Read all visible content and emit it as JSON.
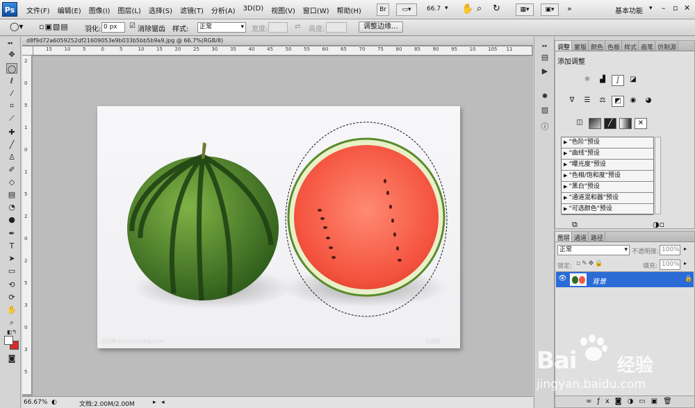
{
  "app": {
    "logo": "Ps"
  },
  "menubar": {
    "items": [
      "文件(F)",
      "编辑(E)",
      "图像(I)",
      "图层(L)",
      "选择(S)",
      "滤镜(T)",
      "分析(A)",
      "3D(D)",
      "视图(V)",
      "窗口(W)",
      "帮助(H)"
    ],
    "br": "Br",
    "zoom": "66.7",
    "workspace": "基本功能"
  },
  "options": {
    "feather_label": "羽化:",
    "feather_value": "0 px",
    "antialias_label": "消除锯齿",
    "style_label": "样式:",
    "style_value": "正常",
    "width_label": "宽度:",
    "height_label": "高度:",
    "refine_edge": "调整边缘..."
  },
  "document": {
    "tab_title": "d8f9d72a6059252df21609053e9b033b5bb5b9a9.jpg @ 66.7%(RGB/8)",
    "ruler_top": [
      "15",
      "10",
      "5",
      "0",
      "5",
      "10",
      "15",
      "20",
      "25",
      "30",
      "35",
      "40",
      "45",
      "50",
      "55",
      "60",
      "65",
      "70",
      "75",
      "80",
      "85",
      "90",
      "95",
      "10",
      "105",
      "11"
    ],
    "ruler_left": [
      "2",
      "0",
      "5",
      "1",
      "0",
      "1",
      "5",
      "2",
      "0",
      "2",
      "5",
      "3",
      "0",
      "3",
      "5"
    ],
    "watermark_left": "全景网 www.quanjing.com",
    "watermark_right": "全景网"
  },
  "status": {
    "zoom": "66.67%",
    "doc": "文档:2.00M/2.00M"
  },
  "adjust_panel": {
    "tabs": [
      "调整",
      "蒙版",
      "颜色",
      "色板",
      "样式",
      "画笔",
      "仿制源"
    ],
    "title": "添加调整",
    "presets": [
      "\"色阶\"预设",
      "\"曲线\"预设",
      "\"曝光度\"预设",
      "\"色相/饱和度\"预设",
      "\"黑白\"预设",
      "\"通道混和器\"预设",
      "\"可选颜色\"预设"
    ]
  },
  "layers_panel": {
    "tabs": [
      "图层",
      "通道",
      "路径"
    ],
    "blend_mode": "正常",
    "opacity_label": "不透明度:",
    "opacity_value": "100%",
    "lock_label": "锁定:",
    "fill_label": "填充:",
    "fill_value": "100%",
    "layer_name": "背景"
  },
  "watermark": {
    "brand": "Bai",
    "brand2": "经验",
    "url": "jingyan.baidu.com"
  },
  "colors": {
    "foreground": "#ffffff",
    "background": "#d52b2b",
    "selection": "#2b6bd6"
  }
}
